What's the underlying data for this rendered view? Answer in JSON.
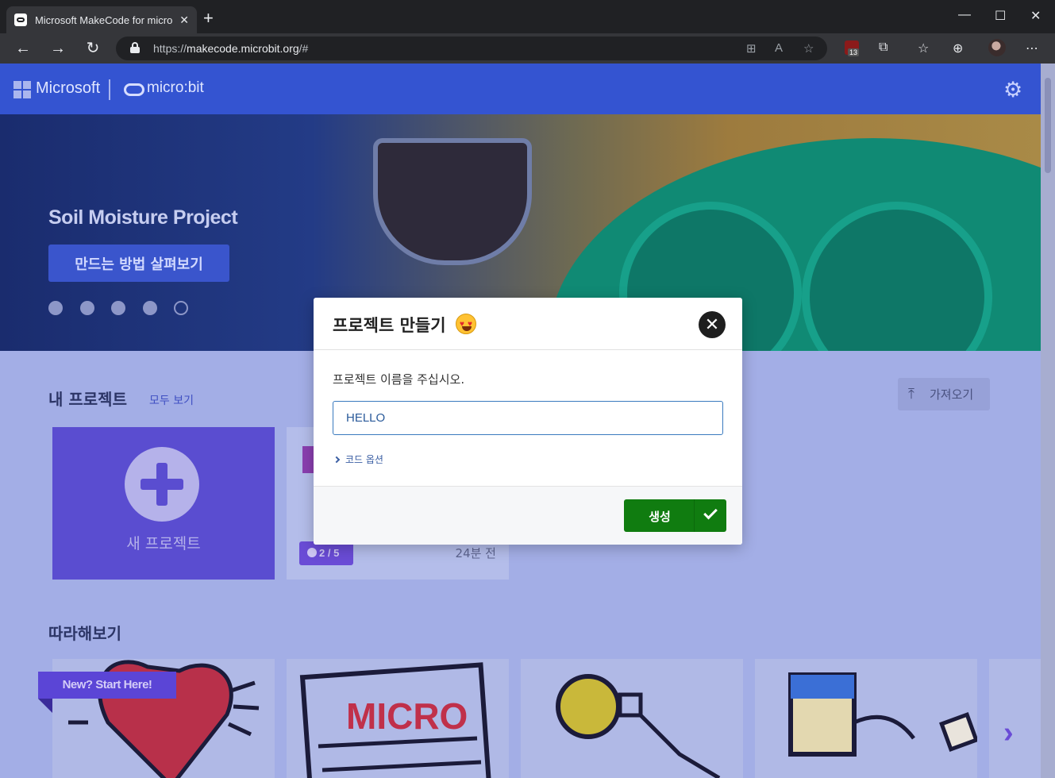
{
  "browser": {
    "tab_title": "Microsoft MakeCode for micro:bit",
    "tab_close": "✕",
    "new_tab": "+",
    "url_prefix": "https://",
    "url_host": "makecode.microbit.org",
    "url_path": "/#",
    "extension_badge": "13"
  },
  "header": {
    "brand": "Microsoft",
    "product": "micro:bit",
    "settings_icon": "⚙"
  },
  "hero": {
    "title": "Soil Moisture Project",
    "button_label": "만드는 방법 살펴보기",
    "slide_count": 5,
    "active_slide": 5
  },
  "my_projects": {
    "title": "내 프로젝트",
    "see_all": "모두 보기",
    "import_label": "가져오기",
    "new_project_label": "새 프로젝트",
    "project_progress": "2 / 5",
    "project_time": "24분 전"
  },
  "tutorials": {
    "title": "따라해보기",
    "ribbon": "New? Start Here!"
  },
  "dialog": {
    "title": "프로젝트 만들기",
    "prompt": "프로젝트 이름을 주십시오.",
    "input_value": "HELLO",
    "code_options": "코드 옵션",
    "create_label": "생성",
    "close_icon": "✕"
  }
}
